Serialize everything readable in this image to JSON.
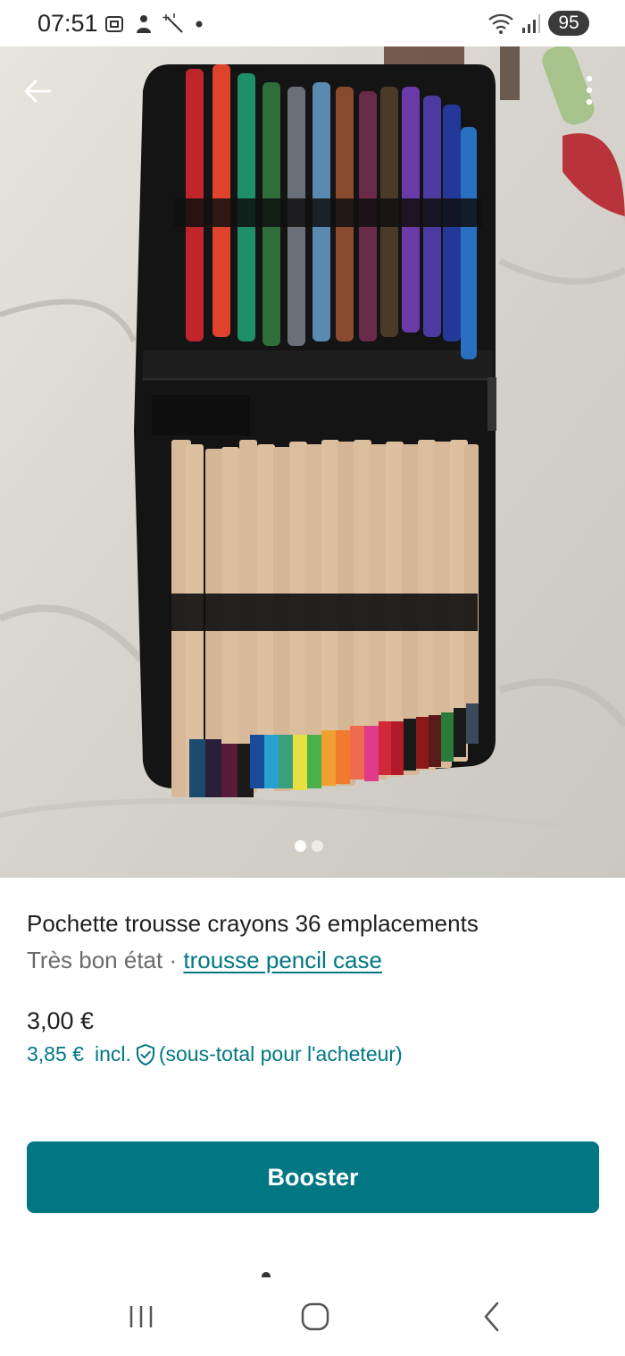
{
  "status_bar": {
    "time": "07:51",
    "battery": "95",
    "left_icons": [
      "screenshot-icon",
      "person-icon",
      "magic-wand-icon",
      "dot-icon"
    ],
    "right_icons": [
      "wifi-icon",
      "signal-icon"
    ]
  },
  "gallery": {
    "image_subject": "black zip pencil case open with felt-tip markers and coloured pencils",
    "page_count": 2,
    "current_page": 1
  },
  "listing": {
    "title": "Pochette trousse crayons 36 emplacements",
    "condition": "Très bon état",
    "separator": "·",
    "category_link": "trousse pencil case",
    "price": "3,00 €",
    "buyer_price": "3,85 €",
    "buyer_incl": "incl.",
    "buyer_note": "(sous-total pour l'acheteur)"
  },
  "actions": {
    "booster_label": "Booster"
  },
  "nav_bar": {
    "icons": [
      "recent-apps-icon",
      "home-icon",
      "back-nav-icon"
    ]
  },
  "colors": {
    "accent": "#007782",
    "text": "#1f1f1f",
    "muted": "#6b6b6b"
  }
}
